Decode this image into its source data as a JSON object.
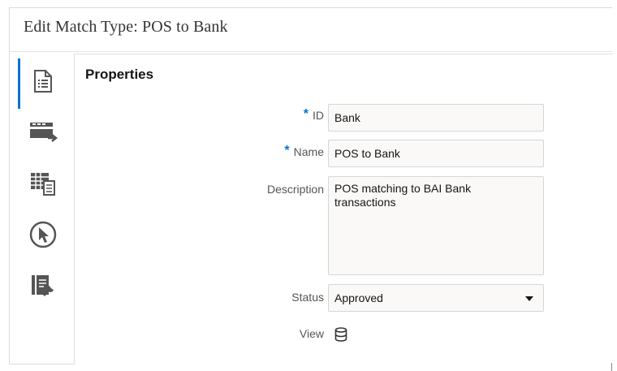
{
  "dialog": {
    "title": "Edit Match Type: POS to Bank"
  },
  "tabs": [
    {
      "icon": "document-list-icon",
      "active": true
    },
    {
      "icon": "card-transfer-icon",
      "active": false
    },
    {
      "icon": "table-document-icon",
      "active": false
    },
    {
      "icon": "cursor-circle-icon",
      "active": false
    },
    {
      "icon": "book-wrench-icon",
      "active": false
    }
  ],
  "properties": {
    "heading": "Properties",
    "id": {
      "label": "ID",
      "required": "*",
      "value": "Bank"
    },
    "name": {
      "label": "Name",
      "required": "*",
      "value": "POS to Bank"
    },
    "description": {
      "label": "Description",
      "value": "POS matching to BAI Bank\ntransactions"
    },
    "status": {
      "label": "Status",
      "value": "Approved"
    },
    "view": {
      "label": "View",
      "icon": "database-icon"
    }
  }
}
